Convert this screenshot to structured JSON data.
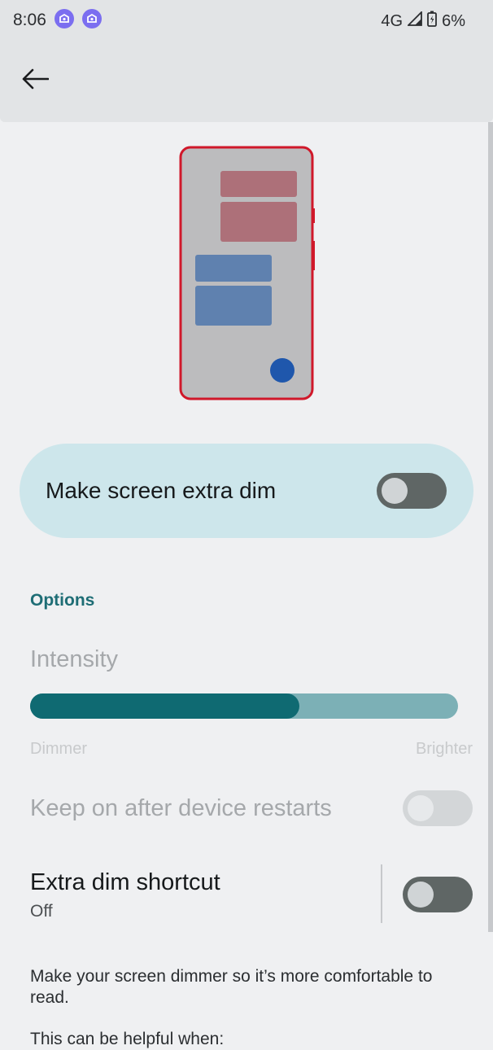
{
  "status_bar": {
    "time": "8:06",
    "notification_icons": [
      "app-notification-icon",
      "app-notification-icon"
    ],
    "network": "4G",
    "battery_percent": "6%"
  },
  "app_bar": {
    "back_icon": "arrow-back-icon"
  },
  "main_toggle": {
    "label": "Make screen extra dim",
    "checked": false
  },
  "options": {
    "header": "Options",
    "intensity": {
      "label": "Intensity",
      "value_fraction": 0.63,
      "min_label": "Dimmer",
      "max_label": "Brighter"
    },
    "keep_on": {
      "label": "Keep on after device restarts",
      "checked": false,
      "enabled": false
    },
    "shortcut": {
      "label": "Extra dim shortcut",
      "summary": "Off",
      "checked": false
    }
  },
  "footer": {
    "description": "Make your screen dimmer so it’s more comfortable to read.",
    "helpful_intro": "This can be helpful when:"
  },
  "colors": {
    "accent": "#0f6a72",
    "card_bg": "#cde6eb",
    "illustration_frame": "#d0182a",
    "illustration_dot": "#1f57ac"
  }
}
